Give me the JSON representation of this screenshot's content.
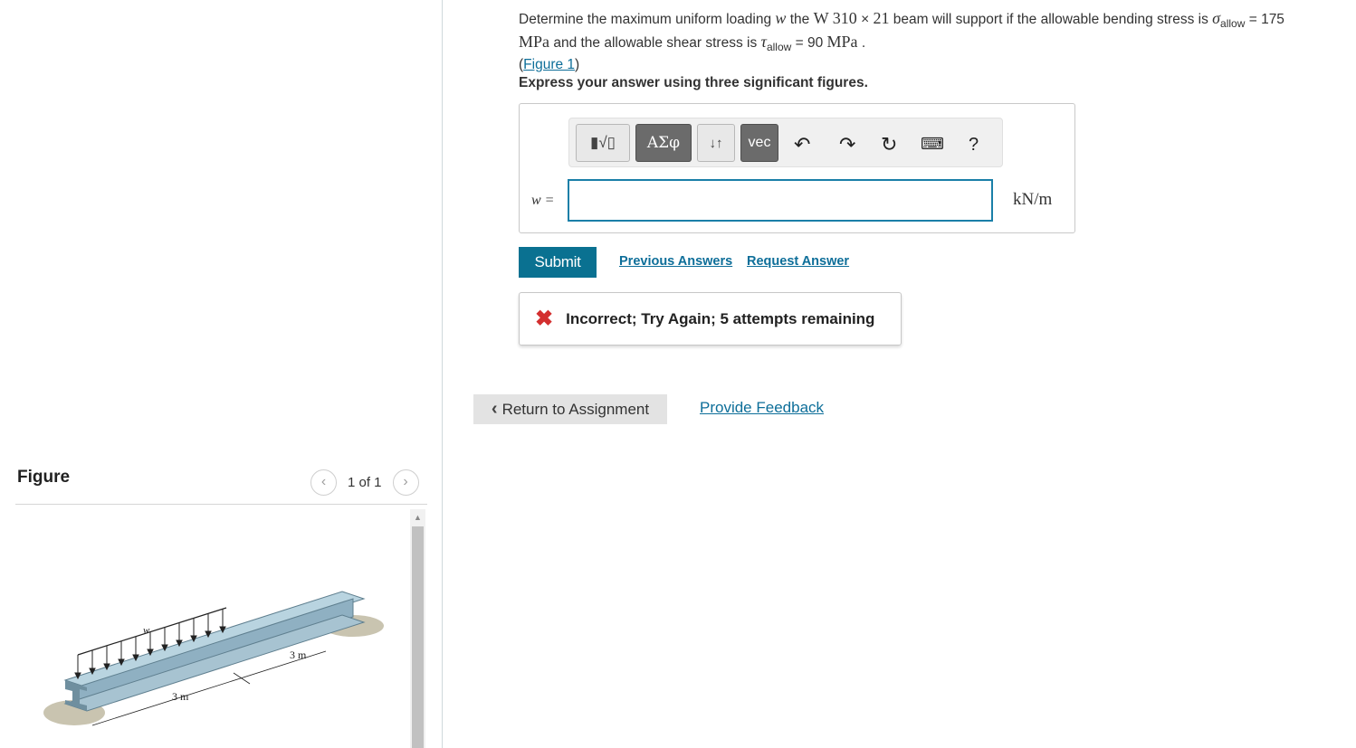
{
  "question": {
    "p1": "Determine the maximum uniform loading ",
    "w_var": "w",
    "p2": " the ",
    "beam_designation": "W 310",
    "times_symbol": "×",
    "beam_weight": "21",
    "p3": " beam will support if the allowable bending stress is ",
    "sigma_symbol": "σ",
    "allow_sub": "allow",
    "sigma_value": " = 175",
    "mpa_unit": "MPa",
    "p4": " and the allowable shear stress is ",
    "tau_symbol": "τ",
    "tau_value": " = 90 ",
    "period": ".",
    "figure_link_open": "(",
    "figure_link": "Figure 1",
    "figure_link_close": ")"
  },
  "instructions": "Express your answer using three significant figures.",
  "toolbar": {
    "templates_label": "▮√▯",
    "greek_label": "ΑΣφ",
    "arrows_label": "↓↑",
    "vec_label": "vec",
    "undo_icon": "undo-icon",
    "redo_icon": "redo-icon",
    "reset_icon": "reset-icon",
    "keyboard_icon": "keyboard-icon",
    "help_label": "?"
  },
  "answer": {
    "variable_label": "w =",
    "value": "",
    "unit": "kN/m"
  },
  "actions": {
    "submit": "Submit",
    "previous_answers": "Previous Answers",
    "request_answer": "Request Answer"
  },
  "feedback": {
    "icon": "x-icon",
    "text": "Incorrect; Try Again; 5 attempts remaining",
    "color": "#d32f2f"
  },
  "footer": {
    "return_label": "Return to Assignment",
    "provide_feedback": "Provide Feedback"
  },
  "figure_panel": {
    "title": "Figure",
    "pager": "1 of 1",
    "prev_icon": "chevron-left-icon",
    "next_icon": "chevron-right-icon",
    "figure_labels": {
      "load": "w",
      "span_left": "3 m",
      "span_right": "3 m"
    }
  },
  "colors": {
    "accent": "#0a7191",
    "link": "#0d6e99",
    "input_border": "#1a7fa8"
  }
}
